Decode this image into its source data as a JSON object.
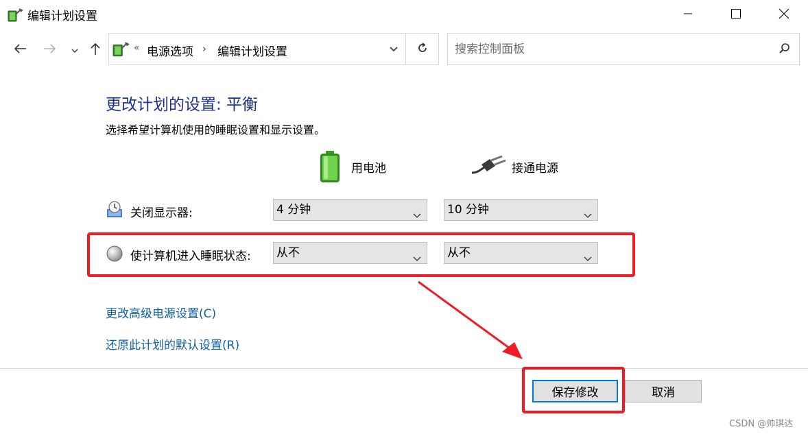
{
  "window": {
    "title": "编辑计划设置",
    "icon": "power-options-icon",
    "controls": [
      "minimize-icon",
      "maximize-icon",
      "close-icon"
    ]
  },
  "nav": {
    "back": "back-arrow-icon",
    "forward": "forward-arrow-icon",
    "recent": "chevron-down-icon",
    "up": "up-arrow-icon"
  },
  "address": {
    "overflow": "«",
    "segments": [
      "电源选项",
      "编辑计划设置"
    ],
    "separator": "›"
  },
  "search": {
    "placeholder": "搜索控制面板"
  },
  "main": {
    "heading": "更改计划的设置: 平衡",
    "subtitle": "选择希望计算机使用的睡眠设置和显示设置。",
    "columns": {
      "battery": "用电池",
      "plugged": "接通电源"
    },
    "rows": [
      {
        "label": "关闭显示器:",
        "battery": "4 分钟",
        "plugged": "10 分钟"
      },
      {
        "label": "使计算机进入睡眠状态:",
        "battery": "从不",
        "plugged": "从不"
      }
    ],
    "links": {
      "advanced": "更改高级电源设置(C)",
      "restore": "还原此计划的默认设置(R)"
    }
  },
  "buttons": {
    "save": "保存修改",
    "cancel": "取消"
  },
  "annotation": {
    "color": "#ee1c25"
  },
  "watermark": "CSDN @帅琪达"
}
